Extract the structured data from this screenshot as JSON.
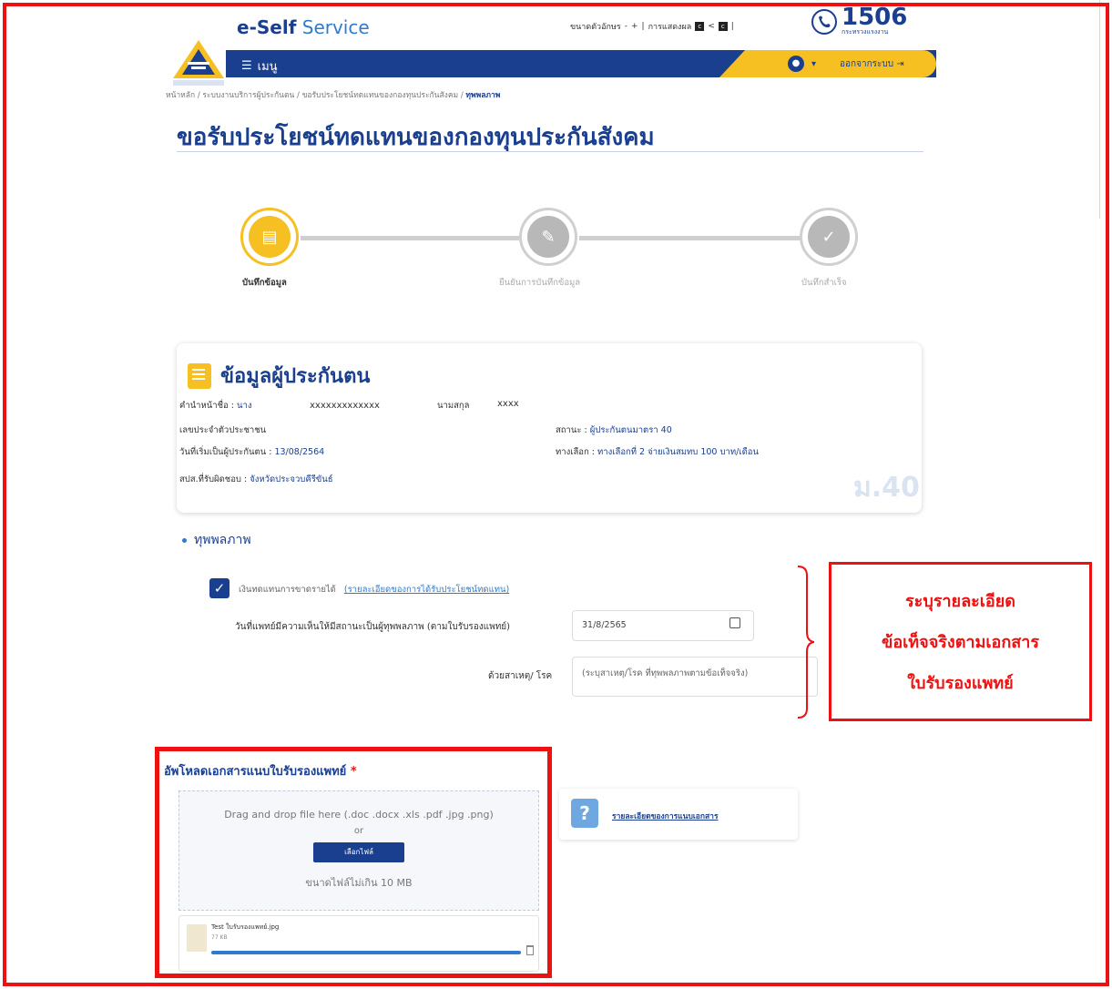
{
  "header": {
    "brand_bold": "e-Self",
    "brand_light": " Service",
    "font_size_label": "ขนาดตัวอักษร",
    "font_minus": "-",
    "font_plus": "+",
    "display_label": "การแสดงผล",
    "contrast_a": "c",
    "contrast_b": "c",
    "hotline_number": "1506",
    "hotline_sub": "กระทรวงแรงงาน",
    "menu_label": "เมนู",
    "logout_label": "ออกจากระบบ"
  },
  "breadcrumb": {
    "path": "หน้าหลัก / ระบบงานบริการผู้ประกันตน / ขอรับประโยชน์ทดแทนของกองทุนประกันสังคม / ",
    "current": "ทุพพลภาพ"
  },
  "page_title": "ขอรับประโยชน์ทดแทนของกองทุนประกันสังคม",
  "steps": [
    {
      "label": "บันทึกข้อมูล",
      "active": true
    },
    {
      "label": "ยืนยันการบันทึกข้อมูล",
      "active": false
    },
    {
      "label": "บันทึกสำเร็จ",
      "active": false
    }
  ],
  "insured": {
    "card_title": "ข้อมูลผู้ประกันตน",
    "prefix_label": "คำนำหน้าชื่อ : ",
    "prefix_value": "นาง",
    "first_name": "xxxxxxxxxxxxx",
    "last_name_label": "นามสกุล",
    "last_name": "xxxx",
    "id_label": "เลขประจำตัวประชาชน",
    "status_label": "สถานะ : ",
    "status_value": "ผู้ประกันตนมาตรา 40",
    "start_date_label": "วันที่เริ่มเป็นผู้ประกันตน : ",
    "start_date_value": "13/08/2564",
    "option_label": "ทางเลือก : ",
    "option_value": "ทางเลือกที่ 2 จ่ายเงินสมทบ 100 บาท/เดือน",
    "office_label": "สปส.ที่รับผิดชอบ : ",
    "office_value": "จังหวัดประจวบคีรีขันธ์",
    "badge": "ม.40"
  },
  "section": {
    "title": "ทุพพลภาพ",
    "checkbox_label": "เงินทดแทนการขาดรายได้",
    "checkbox_link": "(รายละเอียดของการได้รับประโยชน์ทดแทน)",
    "doctor_date_label": "วันที่แพทย์มีความเห็นให้มีสถานะเป็นผู้ทุพพลภาพ (ตามใบรับรองแพทย์)",
    "doctor_date_value": "31/8/2565",
    "cause_label": "ด้วยสาเหตุ/ โรค",
    "cause_placeholder": "(ระบุสาเหตุ/โรค ที่ทุพพลภาพตามข้อเท็จจริง)"
  },
  "callout": {
    "line1": "ระบุรายละเอียด",
    "line2": "ข้อเท็จจริงตามเอกสาร",
    "line3": "ใบรับรองแพทย์"
  },
  "upload": {
    "title": "อัพโหลดเอกสารแนบใบรับรองแพทย์",
    "required_mark": "*",
    "drop_text": "Drag and drop file here (.doc .docx .xls .pdf .jpg .png)",
    "or_text": "or",
    "choose_button": "เลือกไฟล์",
    "max_size": "ขนาดไฟล์ไม่เกิน 10 MB",
    "file_name": "Test ใบรับรองแพทย์.jpg",
    "file_size": "77 KB",
    "progress_percent": 100
  },
  "help": {
    "icon_text": "?",
    "link_text": "รายละเอียดของการแนบเอกสาร"
  },
  "colors": {
    "primary": "#1a3f8f",
    "accent": "#f6c023",
    "annotation": "#ee1111"
  }
}
